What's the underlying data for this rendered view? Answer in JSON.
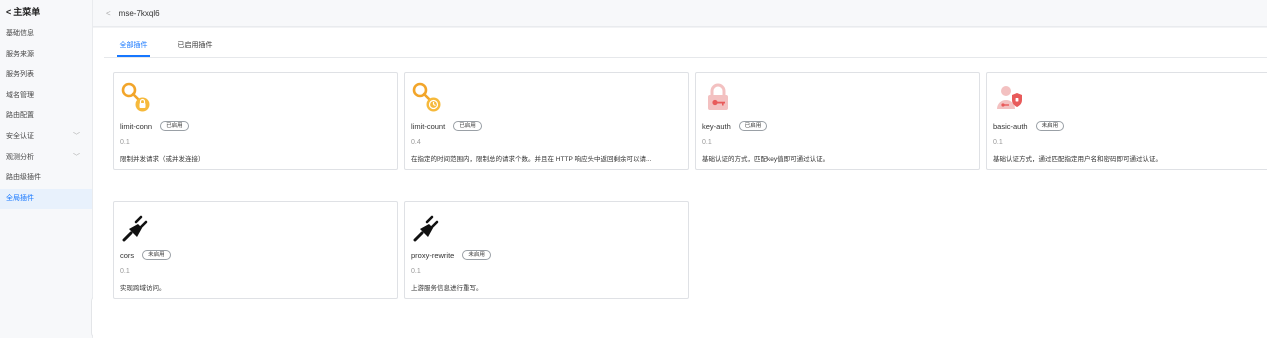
{
  "sidebar": {
    "header": "主菜单",
    "back_glyph": "<",
    "items": [
      {
        "label": "基础信息"
      },
      {
        "label": "服务来源"
      },
      {
        "label": "服务列表"
      },
      {
        "label": "域名管理"
      },
      {
        "label": "路由配置"
      },
      {
        "label": "安全认证"
      },
      {
        "label": "观测分析"
      },
      {
        "label": "路由级插件"
      },
      {
        "label": "全局插件"
      }
    ],
    "active_item": "全局插件",
    "collapse_glyph": "◂"
  },
  "topbar": {
    "back_glyph": "<",
    "instance_name": "mse-7kxql6"
  },
  "tabs": [
    {
      "label": "全部插件",
      "active": true
    },
    {
      "label": "已启用插件",
      "active": false
    }
  ],
  "plugins": [
    {
      "name": "limit-conn",
      "status": "已启用",
      "version": "0.1",
      "description": "限制并发请求（或并发连接）",
      "icon": "key-lock-icon"
    },
    {
      "name": "limit-count",
      "status": "已启用",
      "version": "0.4",
      "description": "在指定的时间范围内，限制总的请求个数。并且在 HTTP 响应头中返回剩余可以请...",
      "icon": "key-count-icon"
    },
    {
      "name": "key-auth",
      "status": "已启用",
      "version": "0.1",
      "description": "基础认证的方式，匹配key值即可通过认证。",
      "icon": "padlock-key-icon"
    },
    {
      "name": "basic-auth",
      "status": "未启用",
      "version": "0.1",
      "description": "基础认证方式，通过匹配指定用户名和密码即可通过认证。",
      "icon": "user-shield-icon"
    },
    {
      "name": "cors",
      "status": "未启用",
      "version": "0.1",
      "description": "实现跨域访问。",
      "icon": "plug-icon"
    },
    {
      "name": "proxy-rewrite",
      "status": "未启用",
      "version": "0.1",
      "description": "上游服务信息进行重写。",
      "icon": "plug-icon"
    }
  ],
  "colors": {
    "accent": "#1677ff",
    "key_orange": "#f2a52a",
    "lock_red": "#e85a5a",
    "lock_pink": "#f3c1c1"
  }
}
